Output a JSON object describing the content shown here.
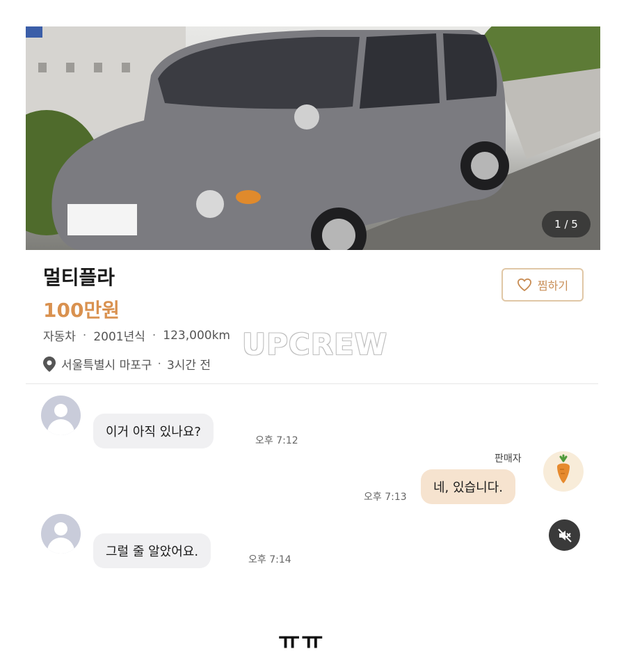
{
  "listing": {
    "photo_counter": "1 / 5",
    "title": "멀티플라",
    "price": "100만원",
    "meta": {
      "category": "자동차",
      "year": "2001년식",
      "mileage": "123,000km"
    },
    "location": {
      "area": "서울특별시 마포구",
      "posted": "3시간 전"
    },
    "favorite_button": {
      "label": "찜하기",
      "icon": "heart-icon"
    }
  },
  "watermark": "UPCREW",
  "chat": {
    "messages": [
      {
        "sender": "buyer",
        "text": "이거 아직 있나요?",
        "time": "오후 7:12"
      },
      {
        "sender": "seller",
        "sender_label": "판매자",
        "text": "네, 있습니다.",
        "time": "오후 7:13"
      },
      {
        "sender": "buyer",
        "text": "그럴 줄 알았어요.",
        "time": "오후 7:14"
      }
    ],
    "mute_icon": "speaker-muted-icon"
  },
  "caption": "ㅠㅠ",
  "colors": {
    "price": "#d9914f",
    "outgoing_bubble": "#f6e3cf",
    "incoming_bubble": "#f0f0f2",
    "favorite_border": "#e0c7a6"
  }
}
